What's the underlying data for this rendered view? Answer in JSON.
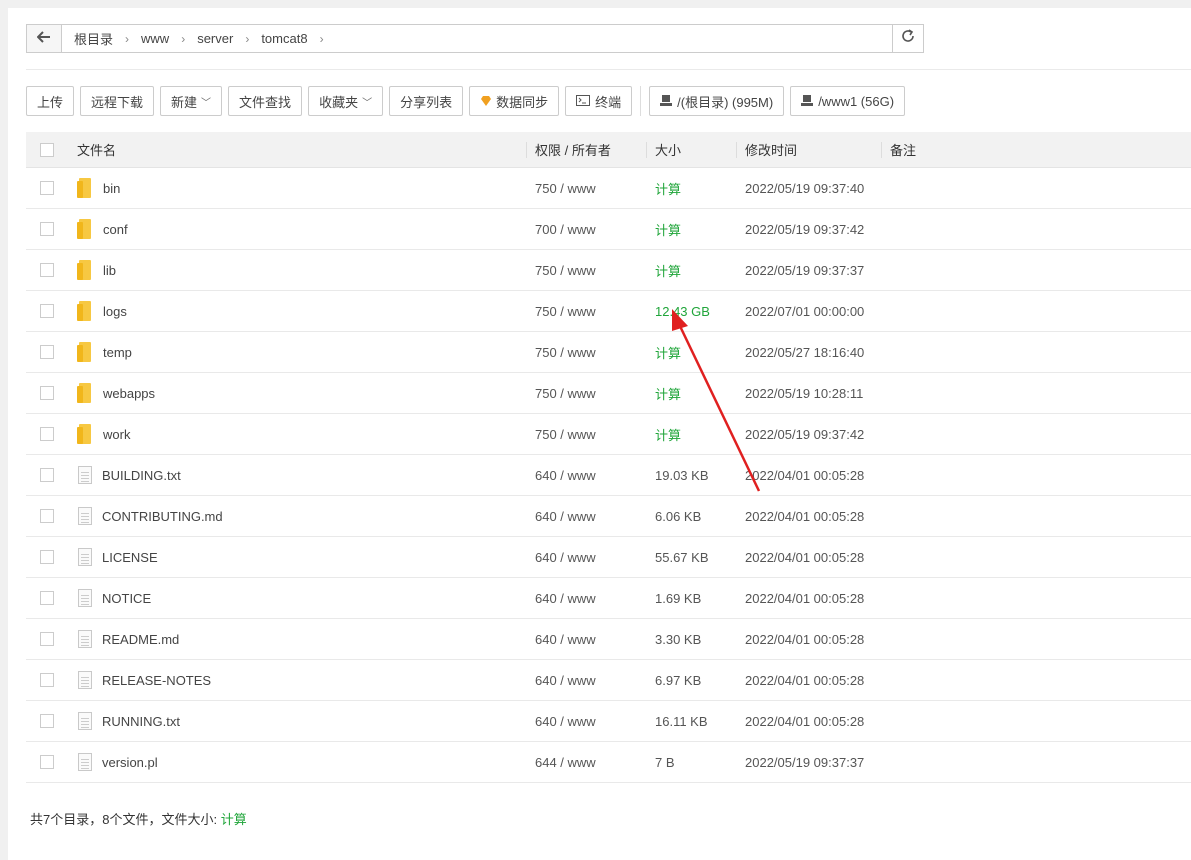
{
  "breadcrumb": [
    "根目录",
    "www",
    "server",
    "tomcat8"
  ],
  "toolbar": {
    "upload": "上传",
    "remote_download": "远程下载",
    "new": "新建",
    "file_search": "文件查找",
    "favorites": "收藏夹",
    "share_list": "分享列表",
    "data_sync": "数据同步",
    "terminal": "终端",
    "disk_root": "/(根目录) (995M)",
    "disk_www": "/www1 (56G)"
  },
  "table": {
    "headers": {
      "name": "文件名",
      "perm": "权限 / 所有者",
      "size": "大小",
      "time": "修改时间",
      "note": "备注"
    },
    "rows": [
      {
        "type": "folder",
        "name": "bin",
        "perm": "750 / www",
        "size": "计算",
        "time": "2022/05/19 09:37:40"
      },
      {
        "type": "folder",
        "name": "conf",
        "perm": "700 / www",
        "size": "计算",
        "time": "2022/05/19 09:37:42"
      },
      {
        "type": "folder",
        "name": "lib",
        "perm": "750 / www",
        "size": "计算",
        "time": "2022/05/19 09:37:37"
      },
      {
        "type": "folder",
        "name": "logs",
        "perm": "750 / www",
        "size": "12.43 GB",
        "time": "2022/07/01 00:00:00"
      },
      {
        "type": "folder",
        "name": "temp",
        "perm": "750 / www",
        "size": "计算",
        "time": "2022/05/27 18:16:40"
      },
      {
        "type": "folder",
        "name": "webapps",
        "perm": "750 / www",
        "size": "计算",
        "time": "2022/05/19 10:28:11"
      },
      {
        "type": "folder",
        "name": "work",
        "perm": "750 / www",
        "size": "计算",
        "time": "2022/05/19 09:37:42"
      },
      {
        "type": "file",
        "name": "BUILDING.txt",
        "perm": "640 / www",
        "size": "19.03 KB",
        "time": "2022/04/01 00:05:28"
      },
      {
        "type": "file",
        "name": "CONTRIBUTING.md",
        "perm": "640 / www",
        "size": "6.06 KB",
        "time": "2022/04/01 00:05:28"
      },
      {
        "type": "file",
        "name": "LICENSE",
        "perm": "640 / www",
        "size": "55.67 KB",
        "time": "2022/04/01 00:05:28"
      },
      {
        "type": "file",
        "name": "NOTICE",
        "perm": "640 / www",
        "size": "1.69 KB",
        "time": "2022/04/01 00:05:28"
      },
      {
        "type": "file",
        "name": "README.md",
        "perm": "640 / www",
        "size": "3.30 KB",
        "time": "2022/04/01 00:05:28"
      },
      {
        "type": "file",
        "name": "RELEASE-NOTES",
        "perm": "640 / www",
        "size": "6.97 KB",
        "time": "2022/04/01 00:05:28"
      },
      {
        "type": "file",
        "name": "RUNNING.txt",
        "perm": "640 / www",
        "size": "16.11 KB",
        "time": "2022/04/01 00:05:28"
      },
      {
        "type": "file",
        "name": "version.pl",
        "perm": "644 / www",
        "size": "7 B",
        "time": "2022/05/19 09:37:37"
      }
    ]
  },
  "footer": {
    "summary": "共7个目录，8个文件，文件大小: ",
    "calc": "计算"
  },
  "colors": {
    "green": "#20a53a",
    "annotation_arrow": "#e02020"
  }
}
